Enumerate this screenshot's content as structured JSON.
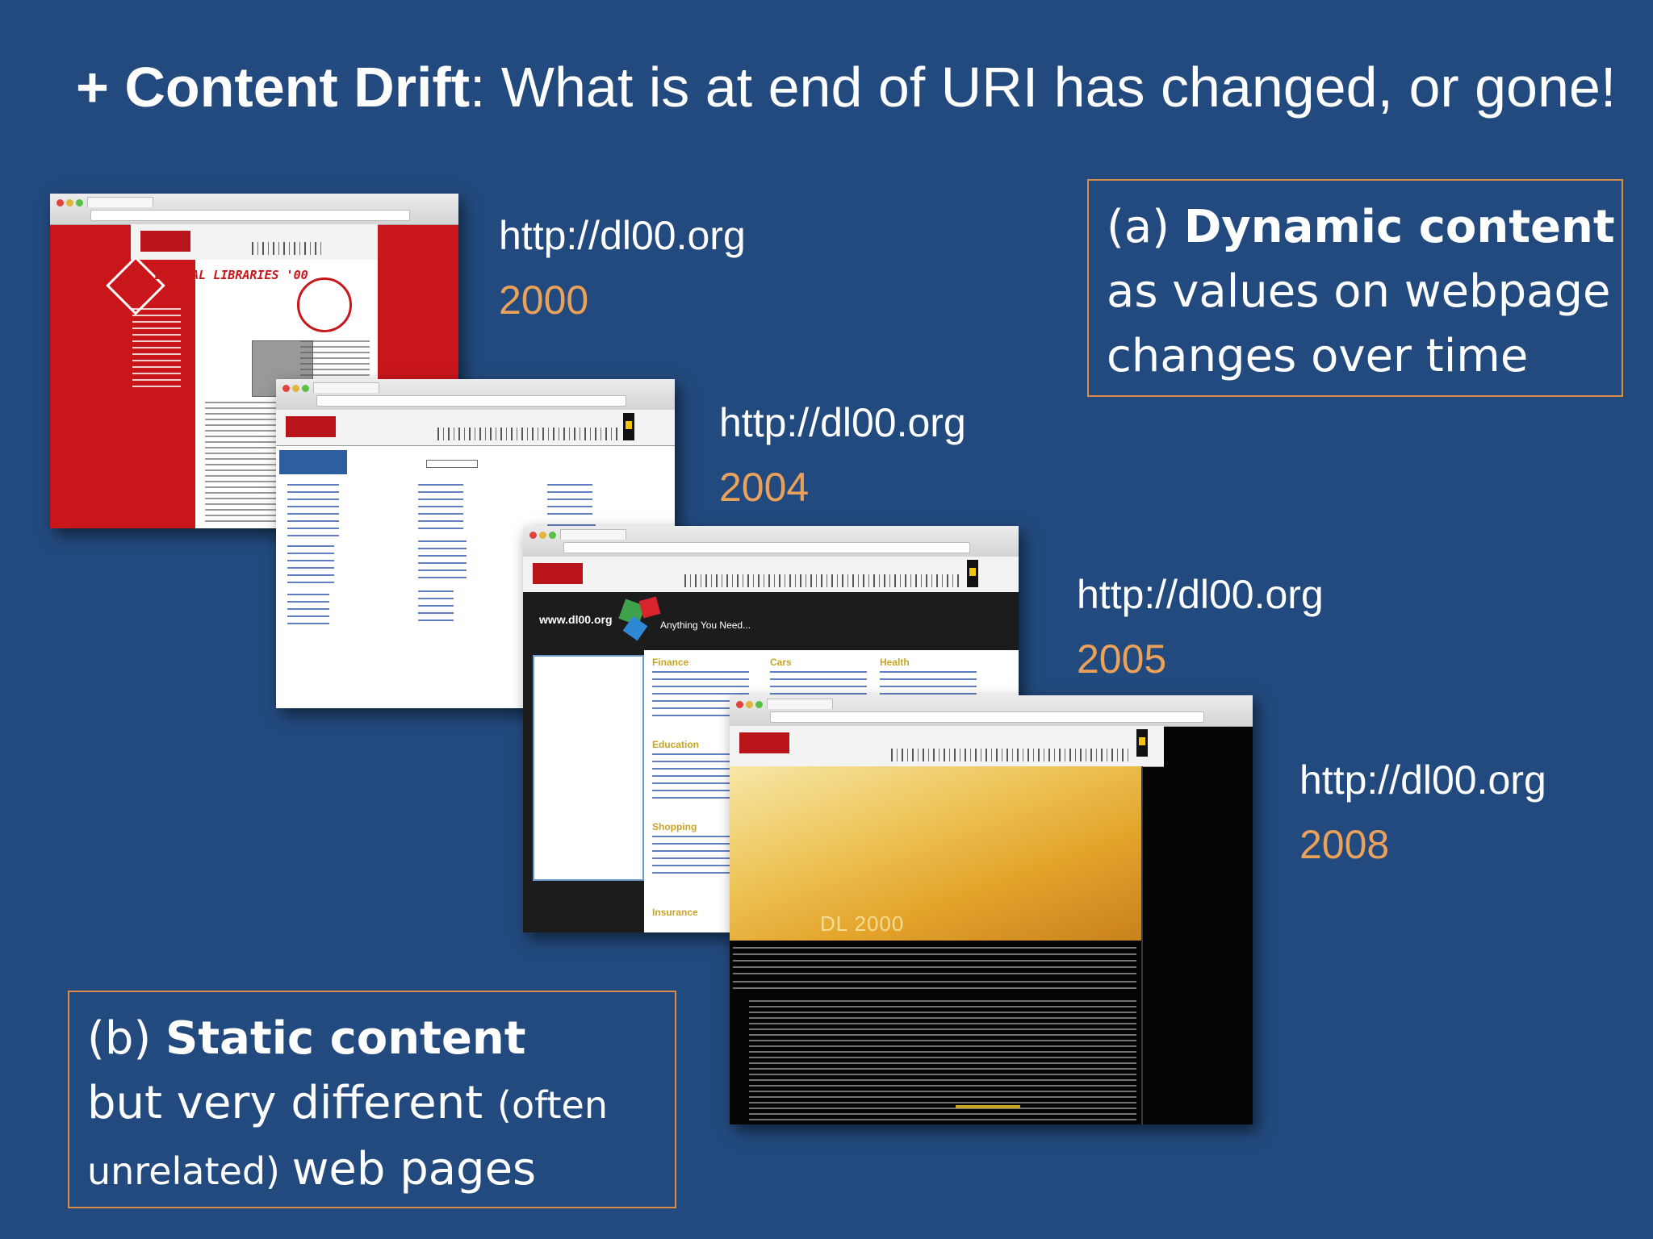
{
  "title": {
    "prefix": "+ Content Drift",
    "rest": ": What is at end of URI has changed, or gone!"
  },
  "snapshots": [
    {
      "url": "http://dl00.org",
      "year": "2000",
      "banner_text": "DIGITAL LIBRARIES '00"
    },
    {
      "url": "http://dl00.org",
      "year": "2004"
    },
    {
      "url": "http://dl00.org",
      "year": "2005",
      "site_name": "www.dl00.org",
      "tagline": "Anything You Need...",
      "sections": [
        "Finance",
        "Cars",
        "Health",
        "Education",
        "Shopping",
        "Insurance"
      ]
    },
    {
      "url": "http://dl00.org",
      "year": "2008",
      "hero_text": "DL 2000"
    }
  ],
  "note_dynamic": {
    "prefix": "(a) ",
    "heading": "Dynamic content",
    "line2": "as values on webpage",
    "line3": "changes over time"
  },
  "note_static": {
    "prefix": "(b) ",
    "heading": "Static content",
    "line2a": "but very different ",
    "line2b": "(often",
    "line3a": "unrelated) ",
    "line3b": "web pages"
  },
  "colors": {
    "background": "#234a7e",
    "year_accent": "#eaa15a",
    "box_border": "#d98c45",
    "site2000_red": "#c8161b"
  }
}
